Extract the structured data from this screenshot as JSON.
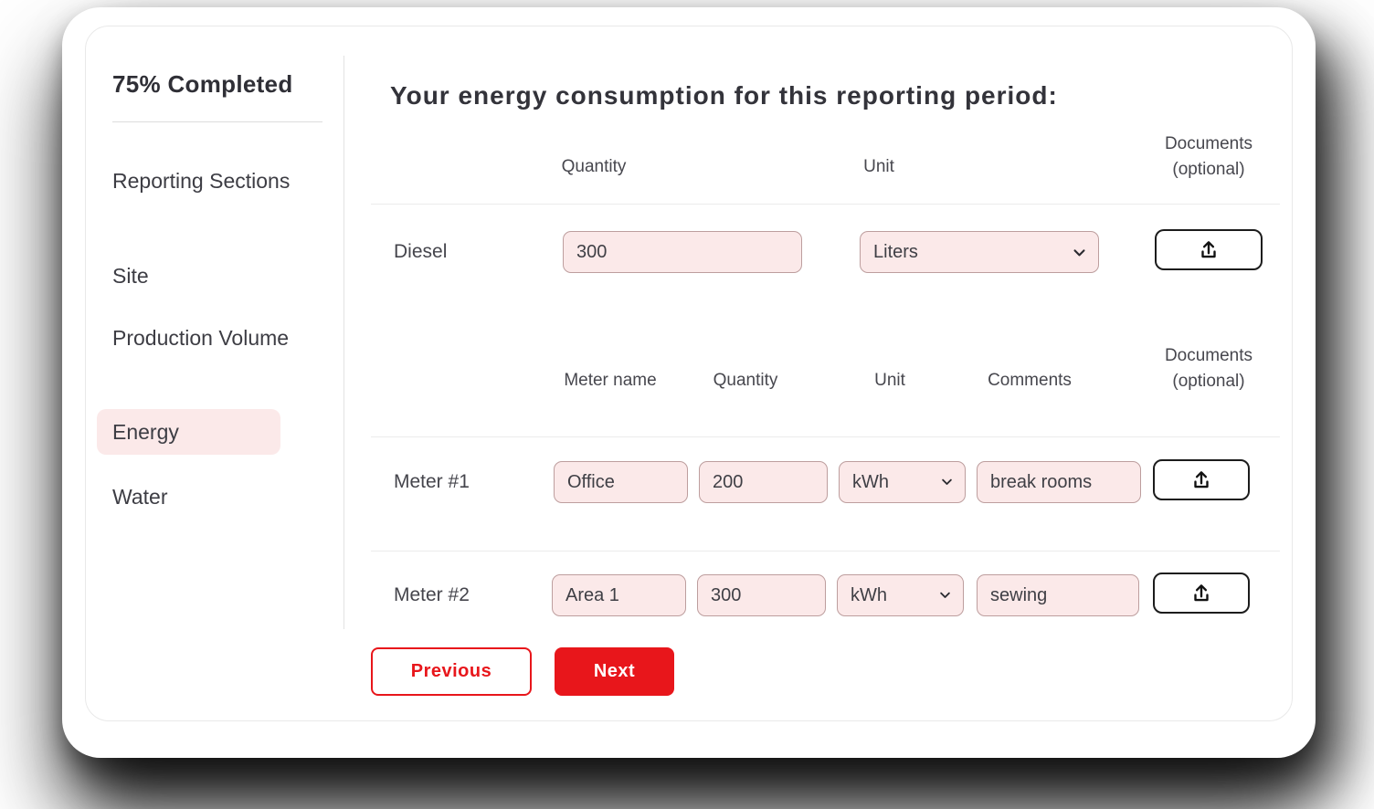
{
  "colors": {
    "accent_red": "#e8161b",
    "pink_fill": "#fbe9e9",
    "pink_border": "#bd9e9e",
    "text_dark": "#35353c",
    "divider": "#ececec"
  },
  "icons": {
    "upload": "upload-icon",
    "chevron_down": "chevron-down-icon"
  },
  "sidebar": {
    "progress_label": "75% Completed",
    "items": [
      {
        "label": "Reporting Sections",
        "active": false
      },
      {
        "label": "Site",
        "active": false
      },
      {
        "label": "Production Volume",
        "active": false
      },
      {
        "label": "Energy",
        "active": true
      },
      {
        "label": "Water",
        "active": false
      }
    ]
  },
  "main": {
    "title": "Your energy consumption for this reporting period:",
    "fuel_table": {
      "headers": {
        "quantity": "Quantity",
        "unit": "Unit",
        "documents_line1": "Documents",
        "documents_line2": "(optional)"
      },
      "row": {
        "label": "Diesel",
        "quantity": "300",
        "unit": "Liters"
      }
    },
    "meter_table": {
      "headers": {
        "meter_name": "Meter name",
        "quantity": "Quantity",
        "unit": "Unit",
        "comments": "Comments",
        "documents_line1": "Documents",
        "documents_line2": "(optional)"
      },
      "rows": [
        {
          "label": "Meter #1",
          "meter_name": "Office",
          "quantity": "200",
          "unit": "kWh",
          "comments": "break rooms"
        },
        {
          "label": "Meter #2",
          "meter_name": "Area 1",
          "quantity": "300",
          "unit": "kWh",
          "comments": "sewing"
        }
      ]
    },
    "buttons": {
      "previous": "Previous",
      "next": "Next"
    }
  }
}
